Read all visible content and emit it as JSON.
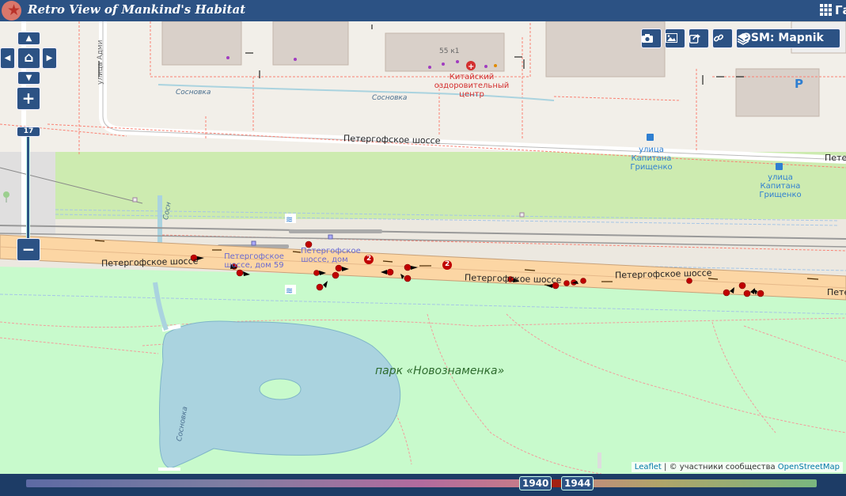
{
  "header": {
    "title": "Retro View of Mankind's Habitat",
    "menu_label": "Га"
  },
  "map": {
    "labels": {
      "street_admiral": "улица Адми",
      "sosnovka_1": "Сосновка",
      "sosnovka_2": "Сосновка",
      "sosnovka_3": "Сосновка",
      "sosnovka_v": "Сосн",
      "building_55k1": "55 к1",
      "clinic": "Китайский оздоровительный центр",
      "peterhof_top": "Петергофское шоссе",
      "peterhof_top_right": "Петер",
      "stop_1": "улица Капитана Грищенко",
      "stop_2": "улица Капитана Грищенко",
      "peterhof_rail_1": "Петергофское шоссе",
      "peterhof_rail_2": "Петергофское шоссе",
      "peterhof_rail_3": "Петергофское шоссе",
      "peterhof_right": "Пете",
      "addr_59": "Петергофское шоссе, дом 59",
      "addr_dom": "Петергофское шоссе, дом",
      "park": "парк «Новознаменка»",
      "parking": "P",
      "route_num_1": "2",
      "route_num_2": "2"
    },
    "controls": {
      "up": "▲",
      "left": "◀",
      "home": "⌂",
      "right": "▶",
      "down": "▼",
      "zoom_in": "+",
      "zoom_out": "−",
      "zoom_level": "17"
    },
    "toolbar": {
      "camera": "camera-icon",
      "image": "image-icon",
      "share": "share-icon",
      "link": "link-icon",
      "layer_label": "OSM: Mapnik"
    },
    "attribution": {
      "leaflet": "Leaflet",
      "sep": " | © участники сообщества ",
      "osm": "OpenStreetMap"
    }
  },
  "timeline": {
    "start": "1940",
    "end": "1944"
  },
  "colors": {
    "header": "#2c5284",
    "road_main": "#fcd6a4",
    "park": "#c8facc",
    "water": "#aad3df",
    "marker": "#c00000"
  }
}
